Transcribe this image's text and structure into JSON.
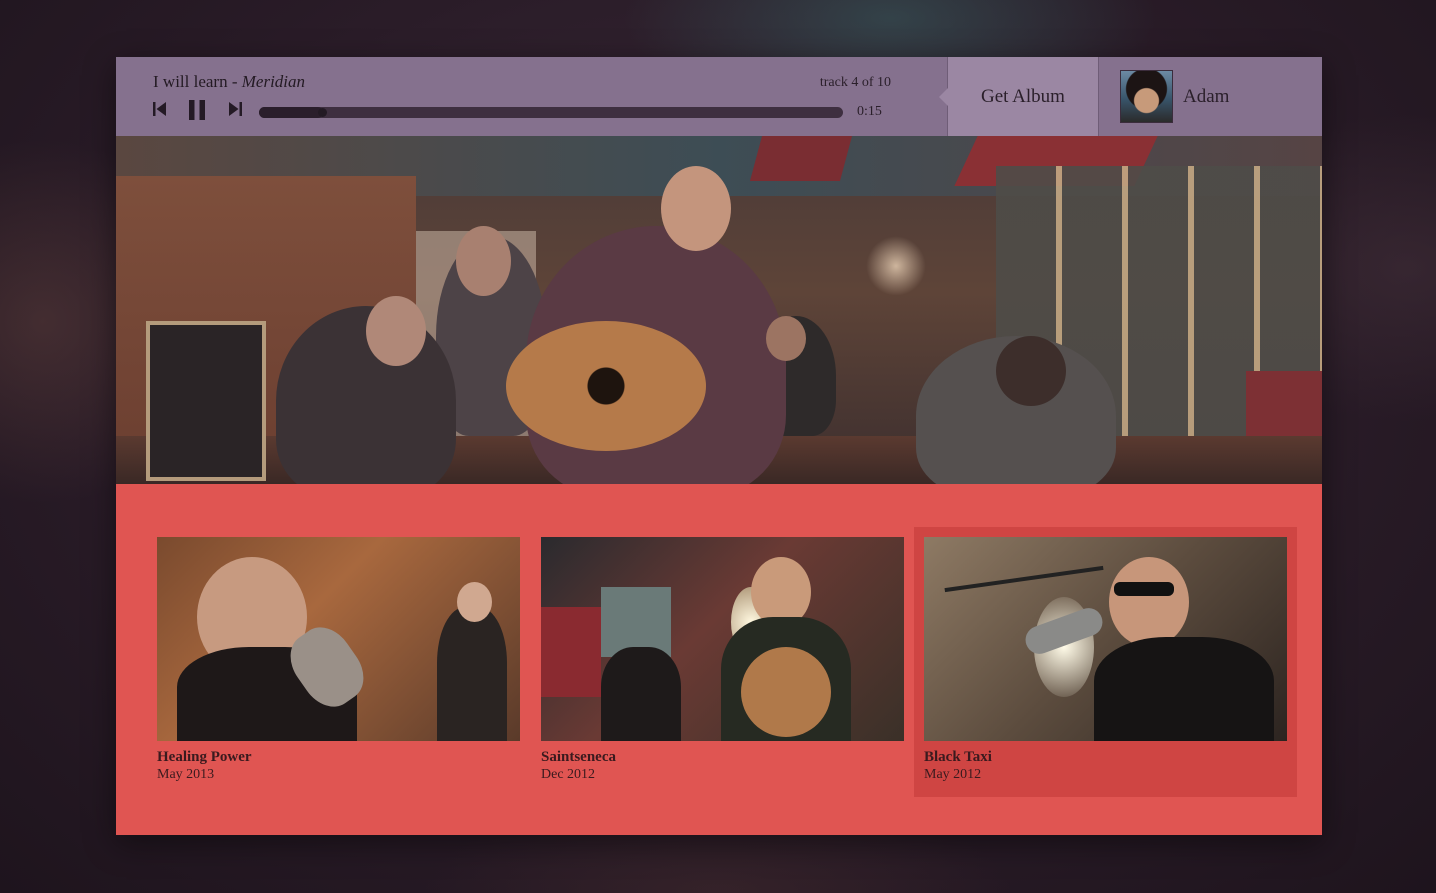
{
  "player": {
    "song": "I will learn",
    "separator": " - ",
    "album": "Meridian",
    "track_count": "track 4 of 10",
    "time": "0:15",
    "progress": 0.11
  },
  "actions": {
    "get_album": "Get Album"
  },
  "user": {
    "name": "Adam"
  },
  "sessions": [
    {
      "title": "Healing Power",
      "date": "May 2013"
    },
    {
      "title": "Saintseneca",
      "date": "Dec 2012"
    },
    {
      "title": "Black Taxi",
      "date": "May 2012"
    }
  ],
  "selected_session": 2,
  "colors": {
    "topbar": "#85718e",
    "get_album_bg": "#9b87a3",
    "list_bg": "#e05552",
    "selected_card": "#cf4543"
  },
  "icons": {
    "prev": "skip-previous-icon",
    "pause": "pause-icon",
    "next": "skip-next-icon"
  }
}
